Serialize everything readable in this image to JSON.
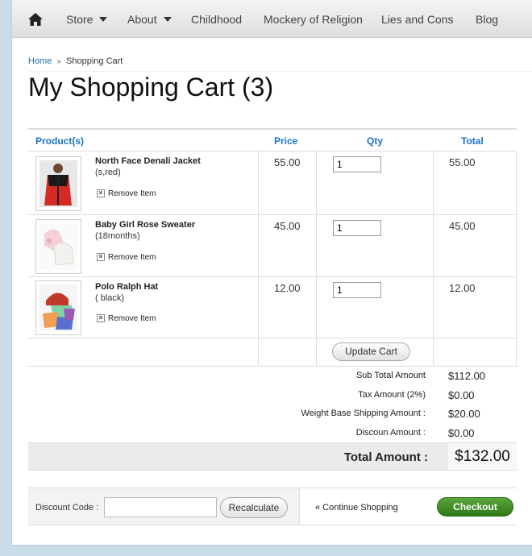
{
  "nav": {
    "home_icon": "home-icon",
    "items": [
      {
        "label": "Store",
        "dropdown": true
      },
      {
        "label": "About",
        "dropdown": true
      },
      {
        "label": "Childhood",
        "dropdown": false
      },
      {
        "label": "Mockery of Religion",
        "dropdown": false
      },
      {
        "label": "Lies and Cons",
        "dropdown": false
      },
      {
        "label": "Blog",
        "dropdown": false
      }
    ]
  },
  "breadcrumb": {
    "home": "Home",
    "separator": "»",
    "current": "Shopping Cart"
  },
  "page_title": "My Shopping Cart (3)",
  "cart": {
    "headers": {
      "product": "Product(s)",
      "price": "Price",
      "qty": "Qty",
      "total": "Total"
    },
    "items": [
      {
        "name": "North Face Denali Jacket",
        "variant": "(s,red)",
        "remove": "Remove Item",
        "price": "55.00",
        "qty": "1",
        "total": "55.00"
      },
      {
        "name": "Baby Girl Rose Sweater",
        "variant": "(18months)",
        "remove": "Remove Item",
        "price": "45.00",
        "qty": "1",
        "total": "45.00"
      },
      {
        "name": "Polo Ralph Hat",
        "variant": "( black)",
        "remove": "Remove Item",
        "price": "12.00",
        "qty": "1",
        "total": "12.00"
      }
    ],
    "update_label": "Update Cart"
  },
  "summary": {
    "subtotal_label": "Sub Total Amount",
    "subtotal": "$112.00",
    "tax_label": "Tax Amount (2%)",
    "tax": "$0.00",
    "shipping_label": "Weight Base Shipping Amount :",
    "shipping": "$20.00",
    "discount_label": "Discoun Amount :",
    "discount": "$0.00",
    "total_label": "Total Amount :",
    "total": "$132.00"
  },
  "bottom": {
    "discount_code_label": "Discount Code :",
    "discount_code_value": "",
    "recalculate_label": "Recalculate",
    "continue_label": "« Continue Shopping",
    "checkout_label": "Checkout"
  },
  "colors": {
    "link": "#1f6fb2",
    "header_text": "#1a74c6",
    "checkout": "#3d8a25"
  }
}
